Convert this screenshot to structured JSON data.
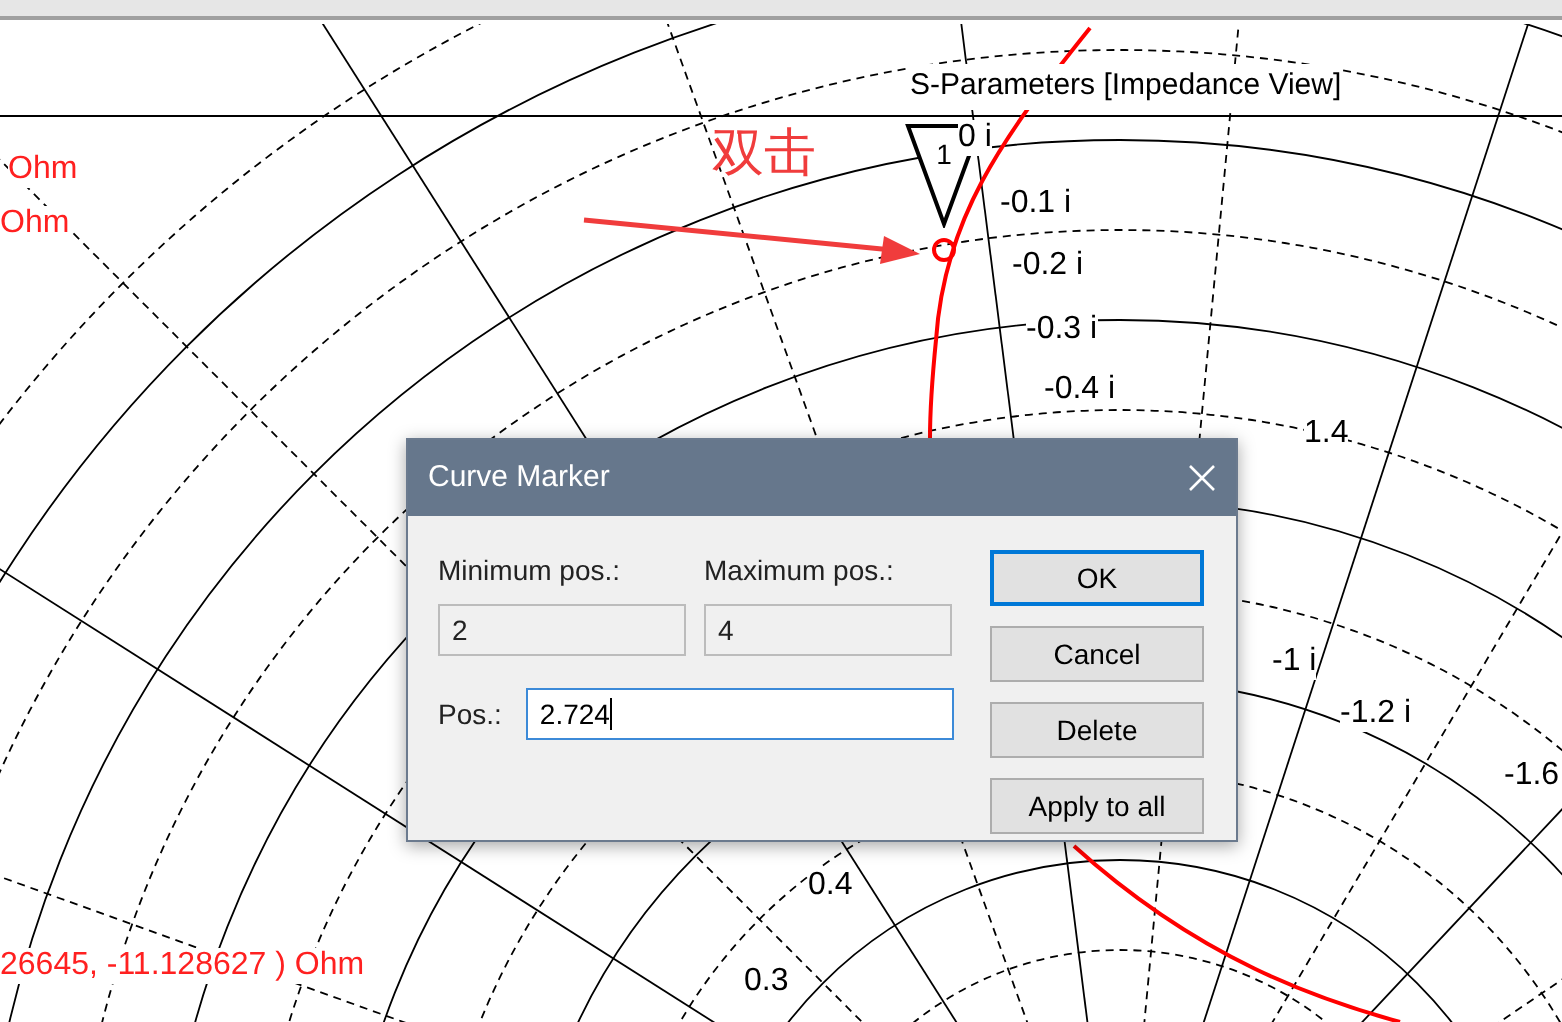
{
  "chart": {
    "title": "S-Parameters [Impedance View]",
    "tick_labels": [
      "0 i",
      "-0.1 i",
      "-0.2 i",
      "-0.3 i",
      "-0.4 i",
      "1.4",
      "-1 i",
      "-1.2 i",
      "-1.6",
      "0.4",
      "0.3"
    ],
    "marker": {
      "label": "1"
    },
    "readouts": [
      "Ohm",
      "Ohm",
      "26645, -11.128627 ) Ohm"
    ]
  },
  "annotation": {
    "text": "双击"
  },
  "dialog": {
    "title": "Curve Marker",
    "fields": [
      {
        "label": "Minimum pos.:",
        "value": "2",
        "disabled": true
      },
      {
        "label": "Maximum pos.:",
        "value": "4",
        "disabled": true
      },
      {
        "label": "Pos.:",
        "value": "2.724",
        "disabled": false
      }
    ],
    "buttons": [
      {
        "label": "OK",
        "selected": true
      },
      {
        "label": "Cancel",
        "selected": false
      },
      {
        "label": "Delete",
        "selected": false
      },
      {
        "label": "Apply to all",
        "selected": false
      }
    ]
  }
}
